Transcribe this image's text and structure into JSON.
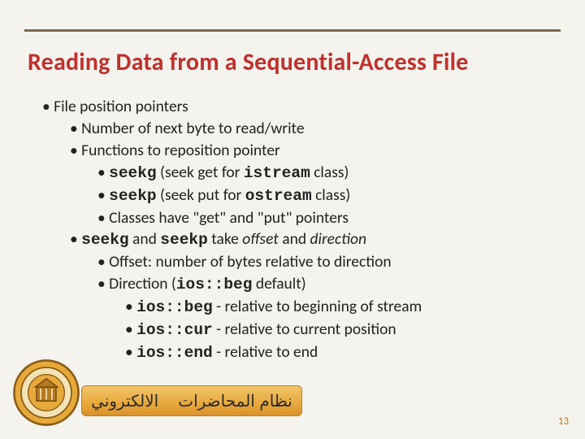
{
  "title": "Reading Data from a Sequential-Access File",
  "bullets": {
    "l1": "File position pointers",
    "l2": "Number of next byte to read/write",
    "l3": "Functions to reposition pointer",
    "l4_pre": "seekg",
    "l4_mid": " (seek get for ",
    "l4_code": "istream",
    "l4_post": " class)",
    "l5_pre": "seekp",
    "l5_mid": " (seek put for ",
    "l5_code": "ostream",
    "l5_post": " class)",
    "l6": "Classes have \"get\" and \"put\" pointers",
    "l7_a": "seekg",
    "l7_b": " and ",
    "l7_c": "seekp",
    "l7_d": " take ",
    "l7_e": "offset",
    "l7_f": " and ",
    "l7_g": "direction",
    "l8": "Offset: number of bytes relative to direction",
    "l9_a": "Direction (",
    "l9_b": "ios::beg",
    "l9_c": " default)",
    "l10_a": "ios::beg",
    "l10_b": " - relative to beginning of stream",
    "l11_a": "ios::cur",
    "l11_b": " - relative to current position",
    "l12_a": "ios::end",
    "l12_b": " - relative to end"
  },
  "arabic": {
    "left": "الالكتروني",
    "right": "نظام المحاضرات"
  },
  "page_number": "13"
}
